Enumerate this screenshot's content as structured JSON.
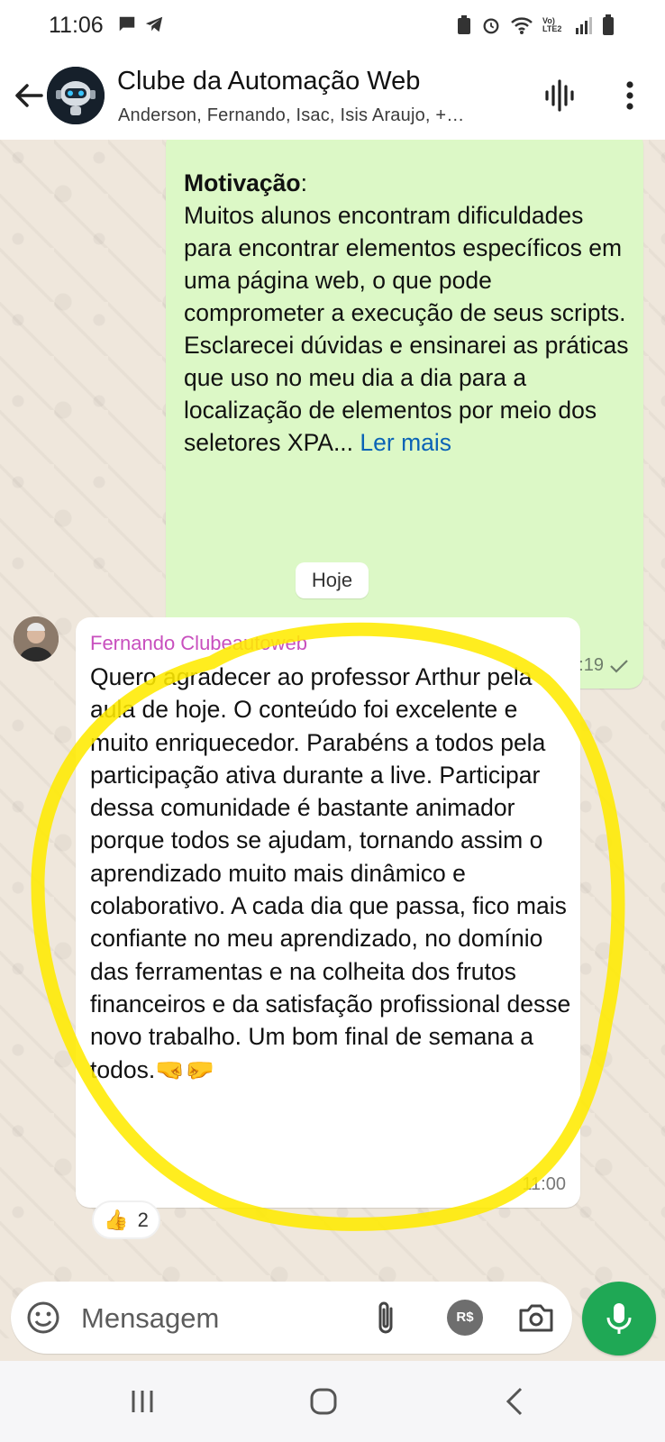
{
  "status_bar": {
    "time": "11:06",
    "network_label": "Vo) LTE2"
  },
  "header": {
    "title": "Clube da Automação Web",
    "subtitle": "Anderson, Fernando, Isac, Isis Araujo, +…"
  },
  "messages": {
    "outgoing": {
      "heading": "Motivação",
      "text": ":\nMuitos alunos encontram dificuldades para encontrar elementos específicos em uma página web, o que pode comprometer a execução de seus scripts. Esclarecei dúvidas e ensinarei as práticas que uso no meu dia a dia para a localização de elementos por meio dos seletores XPA... ",
      "read_more": "Ler mais",
      "time": "23:19"
    },
    "date_chip": "Hoje",
    "incoming": {
      "sender": "Fernando Clubeautoweb",
      "text": "Quero agradecer ao professor Arthur pela aula de hoje. O conteúdo foi excelente e muito enriquecedor. Parabéns a todos pela participação ativa durante a live. Participar dessa comunidade é bastante animador porque todos se ajudam, tornando assim o aprendizado muito mais dinâmico e colaborativo. A cada dia que passa, fico mais confiante no meu aprendizado, no domínio das ferramentas e na colheita dos frutos financeiros e da satisfação profissional desse novo trabalho. Um bom final de semana a todos.🤜🤛",
      "time": "11:00",
      "reaction": {
        "emoji": "👍",
        "count": "2"
      }
    }
  },
  "composer": {
    "placeholder": "Mensagem",
    "pay_label": "R$"
  },
  "colors": {
    "outgoing_bubble": "#dcf8c6",
    "sender_name": "#c84fbe",
    "read_more_link": "#0b63b6",
    "mic_button": "#1fa855",
    "highlight": "#ffea00"
  },
  "icons": [
    "back-arrow-icon",
    "group-avatar-icon",
    "voice-chat-icon",
    "more-vert-icon",
    "emoji-icon",
    "attach-icon",
    "camera-icon",
    "mic-icon",
    "check-icon"
  ]
}
